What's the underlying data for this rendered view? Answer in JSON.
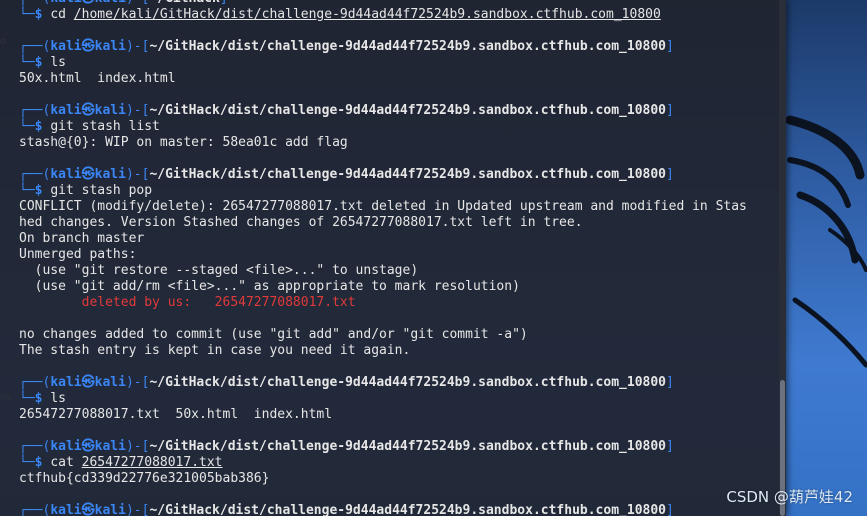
{
  "terminal": {
    "lines": [
      {
        "kind": "prompt-head",
        "user": "kali",
        "host": "kali",
        "path": "~/GitHack"
      },
      {
        "kind": "prompt-cmd",
        "cmd": "cd ",
        "arg": "/home/kali/GitHack/dist/challenge-9d44ad44f72524b9.sandbox.ctfhub.com_10800",
        "underline": true
      },
      {
        "kind": "gap"
      },
      {
        "kind": "prompt-head",
        "user": "kali",
        "host": "kali",
        "path": "~/GitHack/dist/challenge-9d44ad44f72524b9.sandbox.ctfhub.com_10800"
      },
      {
        "kind": "prompt-cmd",
        "cmd": "ls",
        "arg": ""
      },
      {
        "kind": "output",
        "text": "50x.html  index.html"
      },
      {
        "kind": "gap"
      },
      {
        "kind": "prompt-head",
        "user": "kali",
        "host": "kali",
        "path": "~/GitHack/dist/challenge-9d44ad44f72524b9.sandbox.ctfhub.com_10800"
      },
      {
        "kind": "prompt-cmd",
        "cmd": "git stash list",
        "arg": ""
      },
      {
        "kind": "output",
        "text": "stash@{0}: WIP on master: 58ea01c add flag"
      },
      {
        "kind": "gap"
      },
      {
        "kind": "prompt-head",
        "user": "kali",
        "host": "kali",
        "path": "~/GitHack/dist/challenge-9d44ad44f72524b9.sandbox.ctfhub.com_10800"
      },
      {
        "kind": "prompt-cmd",
        "cmd": "git stash pop",
        "arg": ""
      },
      {
        "kind": "output",
        "text": "CONFLICT (modify/delete): 26547277088017.txt deleted in Updated upstream and modified in Stas"
      },
      {
        "kind": "output",
        "text": "hed changes. Version Stashed changes of 26547277088017.txt left in tree."
      },
      {
        "kind": "output",
        "text": "On branch master"
      },
      {
        "kind": "output",
        "text": "Unmerged paths:"
      },
      {
        "kind": "output",
        "text": "  (use \"git restore --staged <file>...\" to unstage)"
      },
      {
        "kind": "output",
        "text": "  (use \"git add/rm <file>...\" as appropriate to mark resolution)"
      },
      {
        "kind": "output-red",
        "text": "        deleted by us:   26547277088017.txt"
      },
      {
        "kind": "gap"
      },
      {
        "kind": "output",
        "text": "no changes added to commit (use \"git add\" and/or \"git commit -a\")"
      },
      {
        "kind": "output",
        "text": "The stash entry is kept in case you need it again."
      },
      {
        "kind": "gap"
      },
      {
        "kind": "prompt-head",
        "user": "kali",
        "host": "kali",
        "path": "~/GitHack/dist/challenge-9d44ad44f72524b9.sandbox.ctfhub.com_10800"
      },
      {
        "kind": "prompt-cmd",
        "cmd": "ls",
        "arg": ""
      },
      {
        "kind": "output",
        "text": "26547277088017.txt  50x.html  index.html"
      },
      {
        "kind": "gap"
      },
      {
        "kind": "prompt-head",
        "user": "kali",
        "host": "kali",
        "path": "~/GitHack/dist/challenge-9d44ad44f72524b9.sandbox.ctfhub.com_10800"
      },
      {
        "kind": "prompt-cmd",
        "cmd": "cat ",
        "arg": "26547277088017.txt",
        "underline": true
      },
      {
        "kind": "output",
        "text": "ctfhub{cd339d22776e321005bab386}"
      },
      {
        "kind": "gap"
      },
      {
        "kind": "prompt-head",
        "user": "kali",
        "host": "kali",
        "path": "~/GitHack/dist/challenge-9d44ad44f72524b9.sandbox.ctfhub.com_10800"
      }
    ]
  },
  "watermark": "CSDN @葫芦娃42",
  "colors": {
    "prompt_blue": "#3a86f5",
    "error_red": "#e03a3a",
    "terminal_bg": "#20242e"
  }
}
